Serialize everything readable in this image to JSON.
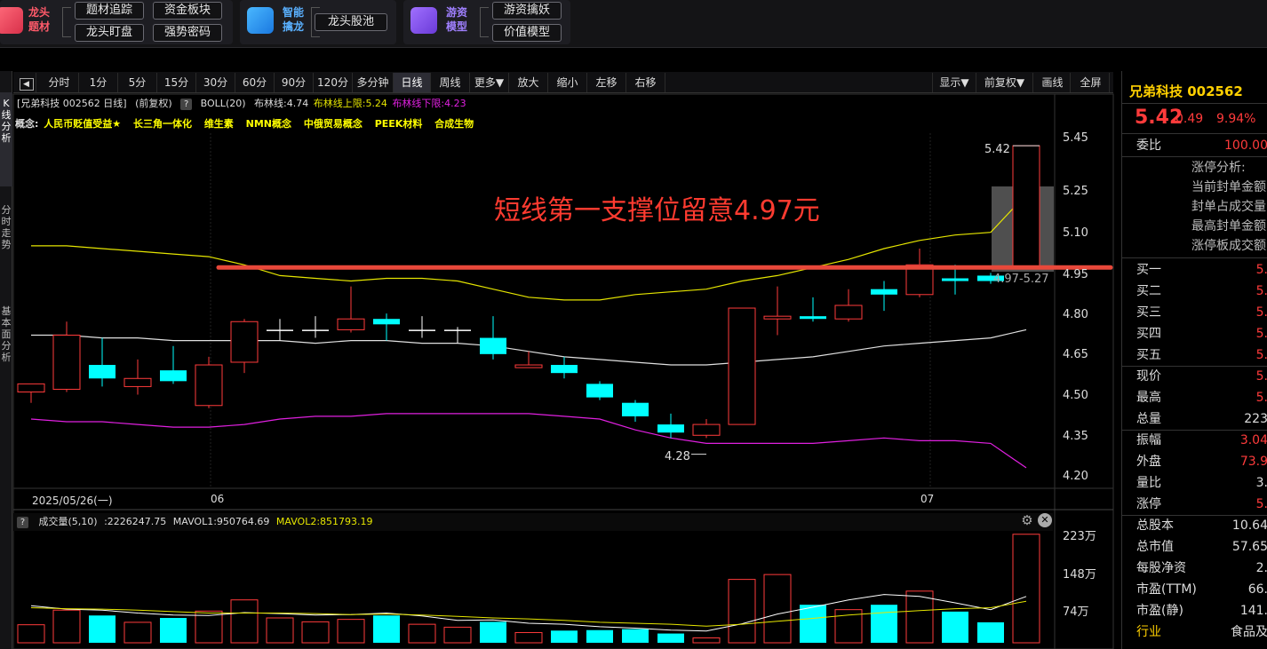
{
  "features": {
    "group1": {
      "title": "龙头题材",
      "buttons": [
        "题材追踪",
        "资金板块",
        "龙头盯盘",
        "强势密码"
      ]
    },
    "group2": {
      "title": "智能擒龙",
      "buttons": [
        "龙头股池"
      ]
    },
    "group3": {
      "title": "游资模型",
      "buttons": [
        "游资擒妖",
        "价值模型"
      ]
    }
  },
  "left_tabs": [
    "K线分析",
    "分时走势",
    "基本面分析"
  ],
  "toolbar": {
    "periods": [
      "分时",
      "1分",
      "5分",
      "15分",
      "30分",
      "60分",
      "90分",
      "120分",
      "多分钟",
      "日线",
      "周线",
      "更多▼",
      "放大",
      "缩小",
      "左移",
      "右移"
    ],
    "active_period": "日线",
    "right_buttons": [
      "显示▼",
      "前复权▼",
      "画线",
      "全屏"
    ]
  },
  "chart_header": {
    "stock": "[兄弟科技 002562 日线]",
    "adjust": "(前复权)",
    "boll_name": "BOLL(20)",
    "boll_mid": "布林线:4.74",
    "boll_upper": "布林线上限:5.24",
    "boll_lower": "布林线下限:4.23"
  },
  "concepts": {
    "label": "概念:",
    "items": [
      "人民币贬值受益★",
      "长三角一体化",
      "维生素",
      "NMN概念",
      "中俄贸易概念",
      "PEEK材料",
      "合成生物"
    ]
  },
  "annotation": "短线第一支撑位留意4.97元",
  "price_labels": {
    "high": "5.42",
    "low": "4.28",
    "range": "4.97-5.27"
  },
  "colors": {
    "up": "#ff3b3b",
    "down": "#00ffff",
    "mid": "#e0e0e0",
    "upper": "#e5e500",
    "lower": "#e020e0",
    "support": "#e8483a"
  },
  "volume_header": {
    "name": "成交量(5,10)",
    "vol": ":2226247.75",
    "mavol1": "MAVOL1:950764.69",
    "mavol2": "MAVOL2:851793.19"
  },
  "chart_data": {
    "type": "candlestick",
    "title": "",
    "x_labels": [
      "2025/05/26(一)",
      "06",
      "07"
    ],
    "y_ticks": [
      "5.45",
      "5.25",
      "5.10",
      "4.95",
      "4.80",
      "4.65",
      "4.50",
      "4.35",
      "4.20"
    ],
    "ylim": [
      4.2,
      5.45
    ],
    "candles": [
      {
        "o": 4.51,
        "c": 4.54,
        "h": 4.54,
        "l": 4.47
      },
      {
        "o": 4.52,
        "c": 4.72,
        "h": 4.77,
        "l": 4.51
      },
      {
        "o": 4.61,
        "c": 4.56,
        "h": 4.71,
        "l": 4.53
      },
      {
        "o": 4.53,
        "c": 4.56,
        "h": 4.63,
        "l": 4.5
      },
      {
        "o": 4.59,
        "c": 4.55,
        "h": 4.68,
        "l": 4.54
      },
      {
        "o": 4.46,
        "c": 4.61,
        "h": 4.64,
        "l": 4.45
      },
      {
        "o": 4.62,
        "c": 4.77,
        "h": 4.78,
        "l": 4.58
      },
      {
        "o": 4.74,
        "c": 4.74,
        "h": 4.78,
        "l": 4.7
      },
      {
        "o": 4.74,
        "c": 4.74,
        "h": 4.79,
        "l": 4.71
      },
      {
        "o": 4.74,
        "c": 4.78,
        "h": 4.9,
        "l": 4.73
      },
      {
        "o": 4.78,
        "c": 4.76,
        "h": 4.8,
        "l": 4.7
      },
      {
        "o": 4.74,
        "c": 4.74,
        "h": 4.79,
        "l": 4.71
      },
      {
        "o": 4.74,
        "c": 4.74,
        "h": 4.75,
        "l": 4.69
      },
      {
        "o": 4.71,
        "c": 4.65,
        "h": 4.79,
        "l": 4.63
      },
      {
        "o": 4.6,
        "c": 4.61,
        "h": 4.66,
        "l": 4.6
      },
      {
        "o": 4.61,
        "c": 4.58,
        "h": 4.64,
        "l": 4.56
      },
      {
        "o": 4.54,
        "c": 4.49,
        "h": 4.55,
        "l": 4.48
      },
      {
        "o": 4.47,
        "c": 4.42,
        "h": 4.48,
        "l": 4.4
      },
      {
        "o": 4.39,
        "c": 4.36,
        "h": 4.43,
        "l": 4.34
      },
      {
        "o": 4.35,
        "c": 4.39,
        "h": 4.41,
        "l": 4.34
      },
      {
        "o": 4.39,
        "c": 4.82,
        "h": 4.82,
        "l": 4.39
      },
      {
        "o": 4.78,
        "c": 4.79,
        "h": 4.9,
        "l": 4.72
      },
      {
        "o": 4.79,
        "c": 4.78,
        "h": 4.86,
        "l": 4.77
      },
      {
        "o": 4.78,
        "c": 4.83,
        "h": 4.89,
        "l": 4.77
      },
      {
        "o": 4.89,
        "c": 4.87,
        "h": 4.92,
        "l": 4.81
      },
      {
        "o": 4.87,
        "c": 4.98,
        "h": 5.04,
        "l": 4.86
      },
      {
        "o": 4.93,
        "c": 4.92,
        "h": 4.98,
        "l": 4.87
      },
      {
        "o": 4.94,
        "c": 4.92,
        "h": 4.95,
        "l": 4.91
      },
      {
        "o": 4.97,
        "c": 5.42,
        "h": 5.42,
        "l": 4.97
      }
    ],
    "boll_mid": [
      4.72,
      4.72,
      4.71,
      4.71,
      4.7,
      4.7,
      4.7,
      4.7,
      4.69,
      4.7,
      4.7,
      4.69,
      4.69,
      4.68,
      4.66,
      4.64,
      4.63,
      4.62,
      4.61,
      4.61,
      4.62,
      4.63,
      4.64,
      4.66,
      4.68,
      4.69,
      4.7,
      4.71,
      4.74
    ],
    "boll_upper": [
      5.05,
      5.05,
      5.04,
      5.03,
      5.02,
      5.01,
      4.98,
      4.94,
      4.93,
      4.92,
      4.93,
      4.93,
      4.92,
      4.89,
      4.86,
      4.85,
      4.85,
      4.87,
      4.88,
      4.89,
      4.92,
      4.94,
      4.97,
      5.0,
      5.04,
      5.07,
      5.09,
      5.1,
      5.24
    ],
    "boll_lower": [
      4.41,
      4.4,
      4.4,
      4.39,
      4.38,
      4.38,
      4.39,
      4.41,
      4.42,
      4.42,
      4.43,
      4.43,
      4.43,
      4.43,
      4.43,
      4.42,
      4.41,
      4.37,
      4.34,
      4.32,
      4.32,
      4.32,
      4.32,
      4.33,
      4.34,
      4.33,
      4.33,
      4.32,
      4.23
    ],
    "support_level": 4.97,
    "volume": {
      "y_ticks": [
        "223万",
        "148万",
        "74万"
      ],
      "ylim": [
        0,
        2240000
      ],
      "values": [
        370000,
        670000,
        560000,
        420000,
        510000,
        650000,
        880000,
        510000,
        430000,
        480000,
        560000,
        380000,
        320000,
        430000,
        210000,
        250000,
        260000,
        280000,
        190000,
        100000,
        1300000,
        1400000,
        780000,
        680000,
        780000,
        1060000,
        640000,
        420000,
        2226247.75
      ],
      "mavol1": [
        760000,
        690000,
        670000,
        610000,
        570000,
        560000,
        620000,
        600000,
        570000,
        580000,
        610000,
        550000,
        460000,
        470000,
        400000,
        380000,
        330000,
        300000,
        260000,
        240000,
        390000,
        590000,
        730000,
        880000,
        990000,
        950000,
        820000,
        680000,
        950764.69
      ],
      "mavol2": [
        720000,
        700000,
        690000,
        670000,
        640000,
        610000,
        610000,
        610000,
        600000,
        580000,
        590000,
        570000,
        540000,
        510000,
        490000,
        460000,
        420000,
        400000,
        380000,
        340000,
        380000,
        440000,
        500000,
        570000,
        620000,
        660000,
        700000,
        720000,
        851793.19
      ]
    }
  },
  "quote": {
    "name": "兄弟科技 002562",
    "price": "5.42",
    "change": "0.49",
    "pct": "9.94%",
    "weibi_label": "委比",
    "weibi_value": "100.00",
    "limit_analysis": [
      "涨停分析:",
      "当前封单金额",
      "封单占成交量",
      "最高封单金额",
      "涨停板成交额"
    ],
    "bids": [
      {
        "label": "买一",
        "value": "5."
      },
      {
        "label": "买二",
        "value": "5."
      },
      {
        "label": "买三",
        "value": "5."
      },
      {
        "label": "买四",
        "value": "5."
      },
      {
        "label": "买五",
        "value": "5."
      }
    ],
    "stats": [
      {
        "label": "现价",
        "value": "5.",
        "color": "#ff3b3b"
      },
      {
        "label": "最高",
        "value": "5.",
        "color": "#ff3b3b"
      },
      {
        "label": "总量",
        "value": "223",
        "color": "#dddddd"
      },
      {
        "label": "振幅",
        "value": "3.04",
        "color": "#ff3b3b"
      },
      {
        "label": "外盘",
        "value": "73.9",
        "color": "#ff3b3b"
      },
      {
        "label": "量比",
        "value": "3.",
        "color": "#dddddd"
      },
      {
        "label": "涨停",
        "value": "5.",
        "color": "#ff3b3b"
      }
    ],
    "fundamentals": [
      {
        "label": "总股本",
        "value": "10.64"
      },
      {
        "label": "总市值",
        "value": "57.65"
      },
      {
        "label": "每股净资",
        "value": "2."
      },
      {
        "label": "市盈(TTM)",
        "value": "66."
      },
      {
        "label": "市盈(静)",
        "value": "141."
      },
      {
        "label": "行业",
        "value": "食品及"
      }
    ]
  }
}
